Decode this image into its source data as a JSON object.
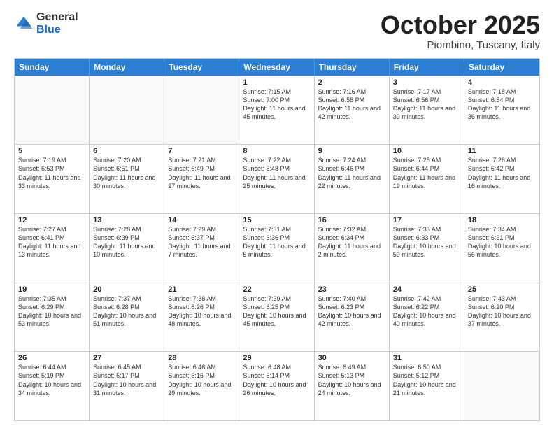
{
  "logo": {
    "general": "General",
    "blue": "Blue"
  },
  "title": "October 2025",
  "location": "Piombino, Tuscany, Italy",
  "header_days": [
    "Sunday",
    "Monday",
    "Tuesday",
    "Wednesday",
    "Thursday",
    "Friday",
    "Saturday"
  ],
  "weeks": [
    [
      {
        "day": "",
        "sunrise": "",
        "sunset": "",
        "daylight": ""
      },
      {
        "day": "",
        "sunrise": "",
        "sunset": "",
        "daylight": ""
      },
      {
        "day": "",
        "sunrise": "",
        "sunset": "",
        "daylight": ""
      },
      {
        "day": "1",
        "sunrise": "Sunrise: 7:15 AM",
        "sunset": "Sunset: 7:00 PM",
        "daylight": "Daylight: 11 hours and 45 minutes."
      },
      {
        "day": "2",
        "sunrise": "Sunrise: 7:16 AM",
        "sunset": "Sunset: 6:58 PM",
        "daylight": "Daylight: 11 hours and 42 minutes."
      },
      {
        "day": "3",
        "sunrise": "Sunrise: 7:17 AM",
        "sunset": "Sunset: 6:56 PM",
        "daylight": "Daylight: 11 hours and 39 minutes."
      },
      {
        "day": "4",
        "sunrise": "Sunrise: 7:18 AM",
        "sunset": "Sunset: 6:54 PM",
        "daylight": "Daylight: 11 hours and 36 minutes."
      }
    ],
    [
      {
        "day": "5",
        "sunrise": "Sunrise: 7:19 AM",
        "sunset": "Sunset: 6:53 PM",
        "daylight": "Daylight: 11 hours and 33 minutes."
      },
      {
        "day": "6",
        "sunrise": "Sunrise: 7:20 AM",
        "sunset": "Sunset: 6:51 PM",
        "daylight": "Daylight: 11 hours and 30 minutes."
      },
      {
        "day": "7",
        "sunrise": "Sunrise: 7:21 AM",
        "sunset": "Sunset: 6:49 PM",
        "daylight": "Daylight: 11 hours and 27 minutes."
      },
      {
        "day": "8",
        "sunrise": "Sunrise: 7:22 AM",
        "sunset": "Sunset: 6:48 PM",
        "daylight": "Daylight: 11 hours and 25 minutes."
      },
      {
        "day": "9",
        "sunrise": "Sunrise: 7:24 AM",
        "sunset": "Sunset: 6:46 PM",
        "daylight": "Daylight: 11 hours and 22 minutes."
      },
      {
        "day": "10",
        "sunrise": "Sunrise: 7:25 AM",
        "sunset": "Sunset: 6:44 PM",
        "daylight": "Daylight: 11 hours and 19 minutes."
      },
      {
        "day": "11",
        "sunrise": "Sunrise: 7:26 AM",
        "sunset": "Sunset: 6:42 PM",
        "daylight": "Daylight: 11 hours and 16 minutes."
      }
    ],
    [
      {
        "day": "12",
        "sunrise": "Sunrise: 7:27 AM",
        "sunset": "Sunset: 6:41 PM",
        "daylight": "Daylight: 11 hours and 13 minutes."
      },
      {
        "day": "13",
        "sunrise": "Sunrise: 7:28 AM",
        "sunset": "Sunset: 6:39 PM",
        "daylight": "Daylight: 11 hours and 10 minutes."
      },
      {
        "day": "14",
        "sunrise": "Sunrise: 7:29 AM",
        "sunset": "Sunset: 6:37 PM",
        "daylight": "Daylight: 11 hours and 7 minutes."
      },
      {
        "day": "15",
        "sunrise": "Sunrise: 7:31 AM",
        "sunset": "Sunset: 6:36 PM",
        "daylight": "Daylight: 11 hours and 5 minutes."
      },
      {
        "day": "16",
        "sunrise": "Sunrise: 7:32 AM",
        "sunset": "Sunset: 6:34 PM",
        "daylight": "Daylight: 11 hours and 2 minutes."
      },
      {
        "day": "17",
        "sunrise": "Sunrise: 7:33 AM",
        "sunset": "Sunset: 6:33 PM",
        "daylight": "Daylight: 10 hours and 59 minutes."
      },
      {
        "day": "18",
        "sunrise": "Sunrise: 7:34 AM",
        "sunset": "Sunset: 6:31 PM",
        "daylight": "Daylight: 10 hours and 56 minutes."
      }
    ],
    [
      {
        "day": "19",
        "sunrise": "Sunrise: 7:35 AM",
        "sunset": "Sunset: 6:29 PM",
        "daylight": "Daylight: 10 hours and 53 minutes."
      },
      {
        "day": "20",
        "sunrise": "Sunrise: 7:37 AM",
        "sunset": "Sunset: 6:28 PM",
        "daylight": "Daylight: 10 hours and 51 minutes."
      },
      {
        "day": "21",
        "sunrise": "Sunrise: 7:38 AM",
        "sunset": "Sunset: 6:26 PM",
        "daylight": "Daylight: 10 hours and 48 minutes."
      },
      {
        "day": "22",
        "sunrise": "Sunrise: 7:39 AM",
        "sunset": "Sunset: 6:25 PM",
        "daylight": "Daylight: 10 hours and 45 minutes."
      },
      {
        "day": "23",
        "sunrise": "Sunrise: 7:40 AM",
        "sunset": "Sunset: 6:23 PM",
        "daylight": "Daylight: 10 hours and 42 minutes."
      },
      {
        "day": "24",
        "sunrise": "Sunrise: 7:42 AM",
        "sunset": "Sunset: 6:22 PM",
        "daylight": "Daylight: 10 hours and 40 minutes."
      },
      {
        "day": "25",
        "sunrise": "Sunrise: 7:43 AM",
        "sunset": "Sunset: 6:20 PM",
        "daylight": "Daylight: 10 hours and 37 minutes."
      }
    ],
    [
      {
        "day": "26",
        "sunrise": "Sunrise: 6:44 AM",
        "sunset": "Sunset: 5:19 PM",
        "daylight": "Daylight: 10 hours and 34 minutes."
      },
      {
        "day": "27",
        "sunrise": "Sunrise: 6:45 AM",
        "sunset": "Sunset: 5:17 PM",
        "daylight": "Daylight: 10 hours and 31 minutes."
      },
      {
        "day": "28",
        "sunrise": "Sunrise: 6:46 AM",
        "sunset": "Sunset: 5:16 PM",
        "daylight": "Daylight: 10 hours and 29 minutes."
      },
      {
        "day": "29",
        "sunrise": "Sunrise: 6:48 AM",
        "sunset": "Sunset: 5:14 PM",
        "daylight": "Daylight: 10 hours and 26 minutes."
      },
      {
        "day": "30",
        "sunrise": "Sunrise: 6:49 AM",
        "sunset": "Sunset: 5:13 PM",
        "daylight": "Daylight: 10 hours and 24 minutes."
      },
      {
        "day": "31",
        "sunrise": "Sunrise: 6:50 AM",
        "sunset": "Sunset: 5:12 PM",
        "daylight": "Daylight: 10 hours and 21 minutes."
      },
      {
        "day": "",
        "sunrise": "",
        "sunset": "",
        "daylight": ""
      }
    ]
  ]
}
